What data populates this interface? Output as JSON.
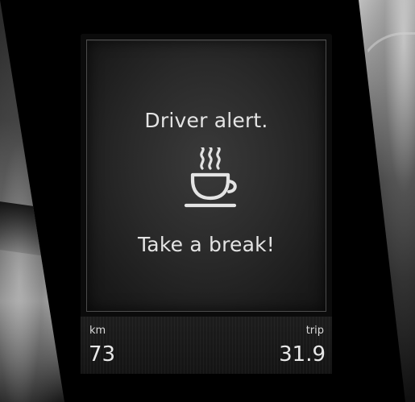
{
  "display": {
    "title": "Driver alert.",
    "message": "Take a break!",
    "icon": "coffee-cup-icon"
  },
  "bottom_bar": {
    "left_label": "km",
    "left_value": "73",
    "right_label": "trip",
    "right_value": "31.9"
  },
  "colors": {
    "text": "#e4e4e4",
    "background": "#0b0b0b",
    "panel_border": "#4c4c4c"
  }
}
